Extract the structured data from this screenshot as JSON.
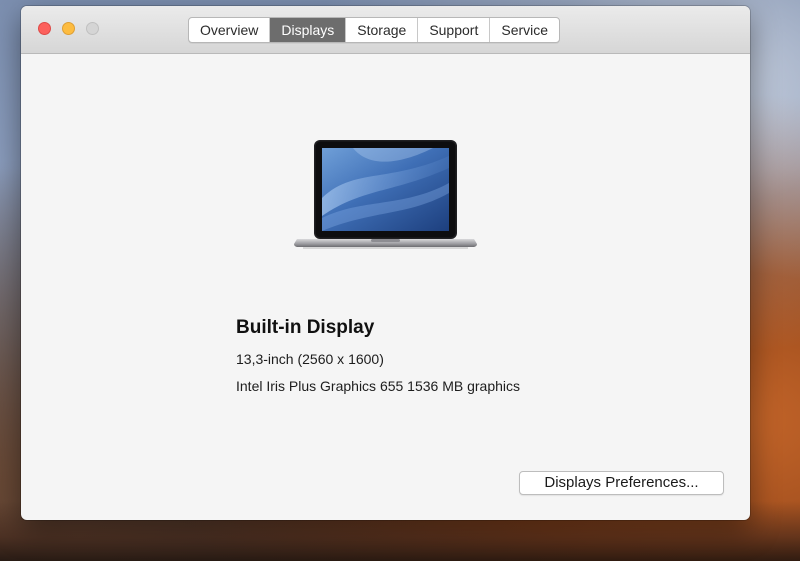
{
  "tabs": [
    {
      "label": "Overview",
      "active": false
    },
    {
      "label": "Displays",
      "active": true
    },
    {
      "label": "Storage",
      "active": false
    },
    {
      "label": "Support",
      "active": false
    },
    {
      "label": "Service",
      "active": false
    }
  ],
  "display": {
    "name": "Built-in Display",
    "size_resolution": "13,3-inch (2560 x 1600)",
    "graphics": "Intel Iris Plus Graphics 655 1536 MB graphics"
  },
  "buttons": {
    "preferences_label": "Displays Preferences..."
  },
  "colors": {
    "close": "#fc605c",
    "minimize": "#fdbc40",
    "zoom_inactive": "#d5d5d5",
    "active_tab": "#6d6d6d"
  },
  "icons": {
    "laptop": "macbook-pro-icon"
  }
}
